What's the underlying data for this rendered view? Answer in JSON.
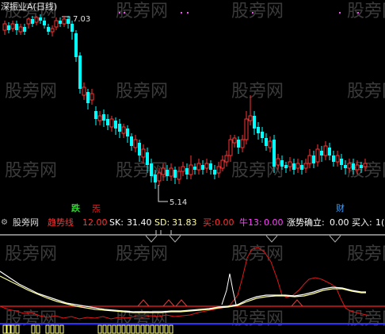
{
  "chart": {
    "title": "深振业A(日线)",
    "high_label": "7.03",
    "low_label": "5.14",
    "signals": {
      "die": "跌",
      "red_mark": "炁",
      "cai": "财"
    },
    "colors": {
      "up": "#ff3333",
      "down": "#00ffff",
      "bg": "#000000",
      "white_line": "#ffffff",
      "yellow_line": "#ffff99",
      "red_line": "#ff2020",
      "bars": "#ffff66",
      "blue": "#4040ff"
    }
  },
  "indicator": {
    "name": "股旁网",
    "trend_label": "趋势线",
    "trend_value": "12.00",
    "sk_label": "SK:",
    "sk_value": "31.40",
    "sd_label": "SD:",
    "sd_value": "31.83",
    "buy_label": "买:",
    "buy_value": "0.00",
    "bull_label": "牛13:",
    "bull_value": "0.00",
    "rise_label": "涨势确立:",
    "rise_value": "0.00",
    "buyin_label": "买入:",
    "buyin_value": "1("
  },
  "watermark": "股旁网",
  "chart_data": {
    "type": "candlestick",
    "high_marker": 7.03,
    "low_marker": 5.14,
    "candles": [
      [
        0,
        1
      ],
      [
        0,
        1
      ],
      [
        1,
        0
      ],
      [
        0,
        1
      ],
      [
        1,
        0
      ],
      [
        1,
        0
      ],
      [
        0,
        1
      ],
      [
        1,
        0
      ],
      [
        0,
        1
      ],
      [
        1,
        0
      ],
      [
        1,
        0
      ],
      [
        0,
        1
      ],
      [
        1,
        0
      ],
      [
        0,
        1
      ],
      [
        0,
        1
      ],
      [
        0,
        1
      ],
      [
        1,
        0
      ],
      [
        0,
        1
      ],
      [
        0,
        1
      ],
      [
        0,
        1
      ],
      [
        1,
        0
      ],
      [
        0,
        1
      ],
      [
        0,
        1
      ],
      [
        0,
        1
      ],
      [
        1,
        0
      ],
      [
        0,
        1
      ],
      [
        1,
        0
      ],
      [
        1,
        0
      ],
      [
        0,
        1
      ],
      [
        1,
        0
      ],
      [
        1,
        0
      ],
      [
        0,
        1
      ],
      [
        1,
        0
      ],
      [
        0,
        1
      ],
      [
        1,
        0
      ],
      [
        1,
        0
      ],
      [
        0,
        1
      ],
      [
        1,
        0
      ],
      [
        0,
        1
      ],
      [
        1,
        0
      ],
      [
        1,
        0
      ],
      [
        1,
        0
      ],
      [
        0,
        1
      ],
      [
        1,
        0
      ],
      [
        0,
        1
      ],
      [
        1,
        0
      ],
      [
        1,
        0
      ],
      [
        0,
        1
      ],
      [
        1,
        0
      ],
      [
        1,
        0
      ],
      [
        0,
        1
      ],
      [
        1,
        0
      ],
      [
        0,
        1
      ],
      [
        1,
        0
      ],
      [
        1,
        0
      ],
      [
        0,
        1
      ],
      [
        1,
        0
      ],
      [
        0,
        1
      ],
      [
        1,
        0
      ],
      [
        0,
        1
      ],
      [
        1,
        0
      ],
      [
        1,
        0
      ],
      [
        0,
        1
      ],
      [
        1,
        0
      ],
      [
        0,
        1
      ],
      [
        1,
        0
      ],
      [
        1,
        0
      ],
      [
        0,
        1
      ],
      [
        1,
        0
      ],
      [
        0,
        1
      ],
      [
        1,
        0
      ],
      [
        0,
        1
      ],
      [
        1,
        0
      ],
      [
        1,
        0
      ],
      [
        0,
        1
      ],
      [
        1,
        0
      ],
      [
        0,
        1
      ]
    ]
  }
}
